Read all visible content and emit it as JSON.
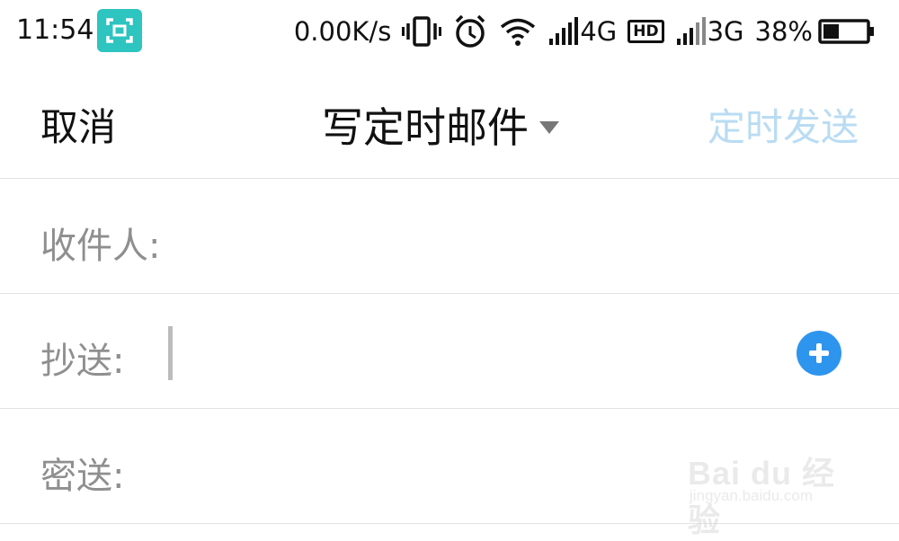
{
  "status_bar": {
    "time": "11:54",
    "network_speed": "0.00K/s",
    "signal1_label": "4G",
    "hd_label": "HD",
    "signal2_label": "3G",
    "battery": "38%",
    "battery_level": 0.38,
    "icons": [
      "screenshot-icon",
      "vibrate-icon",
      "alarm-icon",
      "wifi-icon",
      "signal-icon",
      "hd-icon",
      "battery-icon"
    ]
  },
  "header": {
    "cancel_label": "取消",
    "title": "写定时邮件",
    "send_label": "定时发送",
    "send_color": "#b9dcf3"
  },
  "fields": {
    "to_label": "收件人:",
    "cc_label": "抄送:",
    "bcc_label": "密送:",
    "to_value": "",
    "cc_value": "",
    "bcc_value": ""
  },
  "accent_color": "#2e95ee",
  "watermark": {
    "brand": "Bai du 经验",
    "url": "jingyan.baidu.com"
  }
}
